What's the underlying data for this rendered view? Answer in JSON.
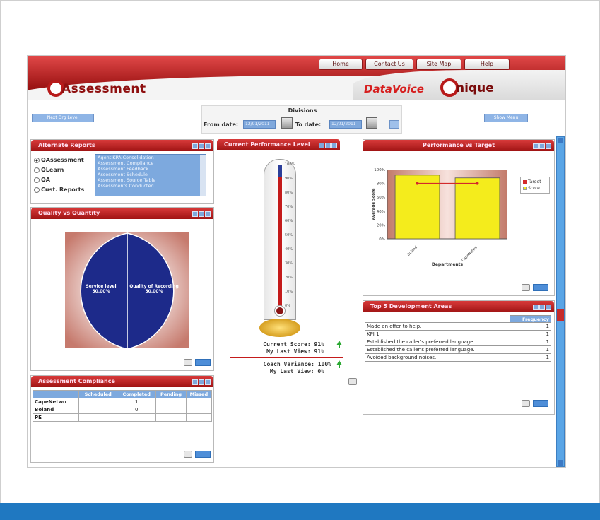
{
  "nav": {
    "home": "Home",
    "contact": "Contact Us",
    "site_map": "Site Map",
    "help": "Help"
  },
  "brand": {
    "left_logo": "Assessment",
    "center_logo": "DataVoice",
    "right_logo": "nique"
  },
  "toolbar": {
    "left_button": "Next Org Level",
    "right_button": "Show Menu",
    "division_title": "Divisions",
    "from_label": "From date:",
    "from_value": "12/01/2011",
    "to_label": "To date:",
    "to_value": "12/01/2011"
  },
  "alternate_reports": {
    "title": "Alternate Reports",
    "options": [
      "QAssessment",
      "QLearn",
      "QA",
      "Cust. Reports"
    ],
    "selected": "QAssessment",
    "list": [
      "Agent KPA Consolidation",
      "Assessment Compliance",
      "Assessment Feedback",
      "Assessment Schedule",
      "Assessment Source Table",
      "Assessments Conducted"
    ]
  },
  "quality": {
    "title": "Quality vs Quantity",
    "slices": [
      {
        "label": "Service level",
        "value": "50.00%"
      },
      {
        "label": "Quality of Recording",
        "value": "50.00%"
      }
    ]
  },
  "compliance": {
    "title": "Assessment Compliance",
    "headers": [
      "",
      "Scheduled",
      "Completed",
      "Pending",
      "Missed"
    ],
    "rows": [
      {
        "name": "CapeNetwo",
        "scheduled": "",
        "completed": "1",
        "pending": "",
        "missed": ""
      },
      {
        "name": "Boland",
        "scheduled": "",
        "completed": "0",
        "pending": "",
        "missed": ""
      },
      {
        "name": "PE",
        "scheduled": "",
        "completed": "",
        "pending": "",
        "missed": ""
      }
    ]
  },
  "current_performance": {
    "title": "Current Performance Level",
    "level_percent": 91,
    "ticks": [
      "100%",
      "90%",
      "80%",
      "70%",
      "60%",
      "50%",
      "40%",
      "30%",
      "20%",
      "10%",
      "0%"
    ],
    "current_score_label": "Current Score:",
    "current_score": "91%",
    "last_view_label": "My Last View:",
    "last_view": "91%",
    "coach_variance_label": "Coach Variance:",
    "coach_variance": "100%",
    "coach_last_view_label": "My Last View:",
    "coach_last_view": "0%"
  },
  "performance_target": {
    "title": "Performance vs Target",
    "ylabel": "Average Score",
    "xlabel": "Departments",
    "legend": [
      "Target",
      "Score"
    ]
  },
  "chart_data": {
    "type": "bar",
    "categories": [
      "Boland",
      "CapeNetwo"
    ],
    "series": [
      {
        "name": "Score",
        "values": [
          92,
          88
        ],
        "color": "#f4ec1c"
      },
      {
        "name": "Target",
        "values": [
          80,
          80
        ],
        "color": "#d32a2a"
      }
    ],
    "ylim": [
      0,
      100
    ],
    "yticks": [
      "100%",
      "80%",
      "60%",
      "40%",
      "20%",
      "0%"
    ],
    "ylabel": "Average Score",
    "xlabel": "Departments"
  },
  "top5": {
    "title": "Top 5 Development Areas",
    "header": "Frequency",
    "rows": [
      {
        "area": "Made an offer to help.",
        "freq": "1"
      },
      {
        "area": "KPI 1",
        "freq": "1"
      },
      {
        "area": "Established the caller's preferred language.",
        "freq": "1"
      },
      {
        "area": "Established the caller's preferred language.",
        "freq": "1"
      },
      {
        "area": "Avoided background noises.",
        "freq": "1"
      }
    ]
  },
  "colors": {
    "header_red": "#a01414",
    "accent_blue": "#7da9de",
    "pie_blue": "#1d2a8a",
    "bottom_band": "#1f78c1"
  }
}
